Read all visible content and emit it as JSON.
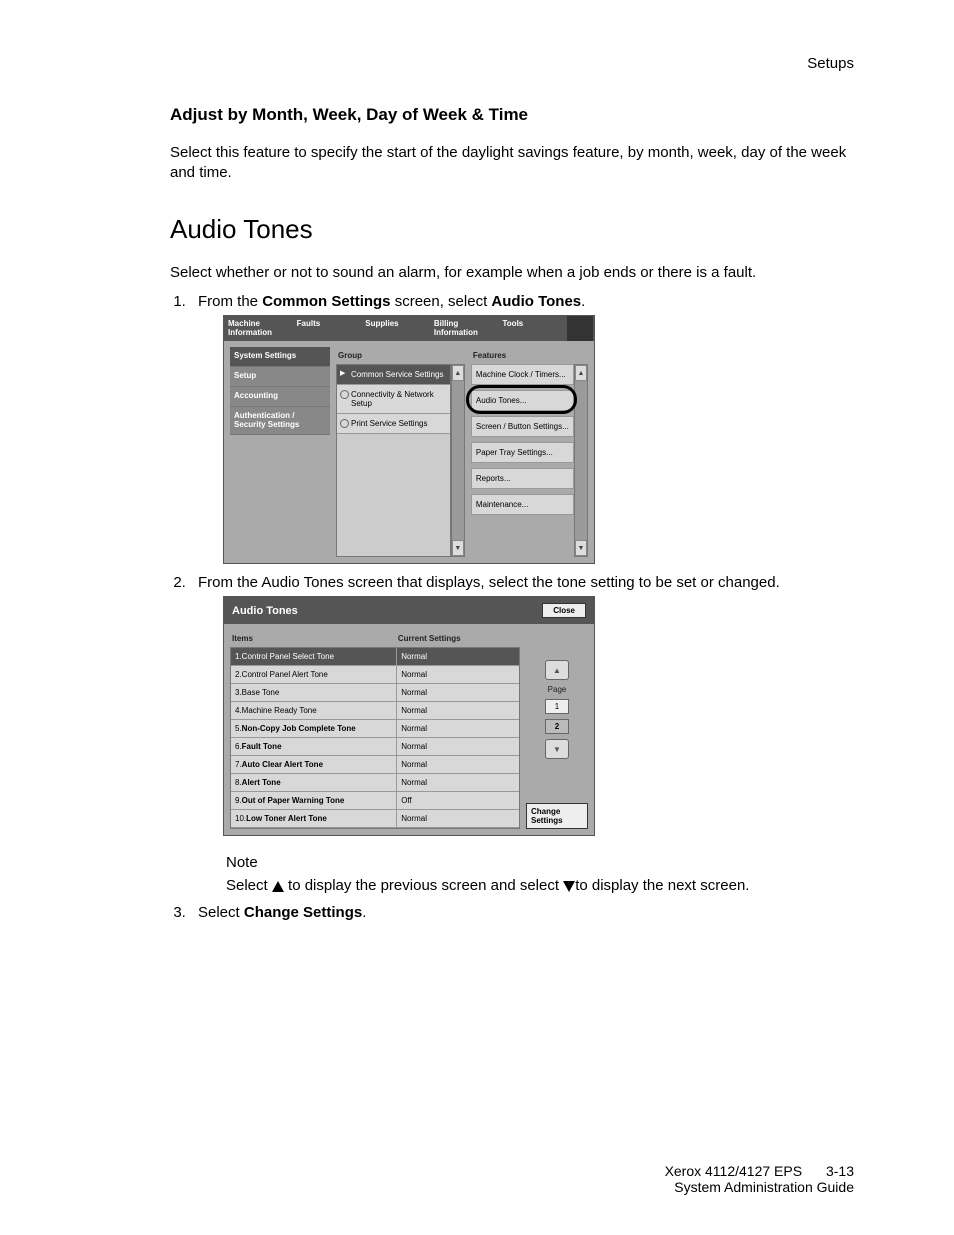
{
  "header": {
    "category": "Setups"
  },
  "section1": {
    "title": "Adjust by Month, Week, Day of Week & Time",
    "body": "Select this feature to specify the start of the daylight savings feature, by month, week, day of the week and time."
  },
  "section2": {
    "title": "Audio Tones",
    "intro": "Select whether or not to sound an alarm, for example when a job ends or there is a fault."
  },
  "steps": {
    "s1_a": "From the ",
    "s1_b": "Common Settings",
    "s1_c": " screen, select ",
    "s1_d": "Audio Tones",
    "s1_e": ".",
    "s2": "From the Audio Tones screen that displays, select the tone setting to be set or changed.",
    "s3_a": "Select ",
    "s3_b": "Change Settings",
    "s3_c": "."
  },
  "sshot1": {
    "tabs": [
      "Machine Information",
      "Faults",
      "Supplies",
      "Billing Information",
      "Tools"
    ],
    "side": [
      "System Settings",
      "Setup",
      "Accounting",
      "Authentication / Security Settings"
    ],
    "group_label": "Group",
    "features_label": "Features",
    "group_items": [
      "Common Service Settings",
      "Connectivity & Network Setup",
      "Print Service Settings"
    ],
    "feature_items": [
      "Machine Clock / Timers...",
      "Audio Tones...",
      "Screen / Button Settings...",
      "Paper Tray Settings...",
      "Reports...",
      "Maintenance..."
    ]
  },
  "sshot2": {
    "title": "Audio Tones",
    "close": "Close",
    "col1": "Items",
    "col2": "Current Settings",
    "rows": [
      {
        "n": "1.",
        "name": "Control Panel Select Tone",
        "val": "Normal",
        "bold": false,
        "sel": true
      },
      {
        "n": "2.",
        "name": "Control Panel Alert Tone",
        "val": "Normal",
        "bold": false,
        "sel": false
      },
      {
        "n": "3.",
        "name": "Base Tone",
        "val": "Normal",
        "bold": false,
        "sel": false
      },
      {
        "n": "4.",
        "name": "Machine Ready Tone",
        "val": "Normal",
        "bold": false,
        "sel": false
      },
      {
        "n": "5.",
        "name": "Non-Copy Job Complete Tone",
        "val": "Normal",
        "bold": true,
        "sel": false
      },
      {
        "n": "6.",
        "name": "Fault Tone",
        "val": "Normal",
        "bold": true,
        "sel": false
      },
      {
        "n": "7.",
        "name": "Auto Clear Alert Tone",
        "val": "Normal",
        "bold": true,
        "sel": false
      },
      {
        "n": "8.",
        "name": "Alert Tone",
        "val": "Normal",
        "bold": true,
        "sel": false
      },
      {
        "n": "9.",
        "name": "Out of Paper Warning Tone",
        "val": "Off",
        "bold": true,
        "sel": false
      },
      {
        "n": "10.",
        "name": "Low Toner Alert Tone",
        "val": "Normal",
        "bold": true,
        "sel": false
      }
    ],
    "page_label": "Page",
    "pages": [
      "1",
      "2"
    ],
    "change": "Change Settings"
  },
  "note": {
    "label": "Note",
    "a": "Select ",
    "b": " to display the previous screen and select ",
    "c": "to display the next screen."
  },
  "footer": {
    "line1": "Xerox 4112/4127 EPS",
    "page": "3-13",
    "line2": "System Administration Guide"
  }
}
